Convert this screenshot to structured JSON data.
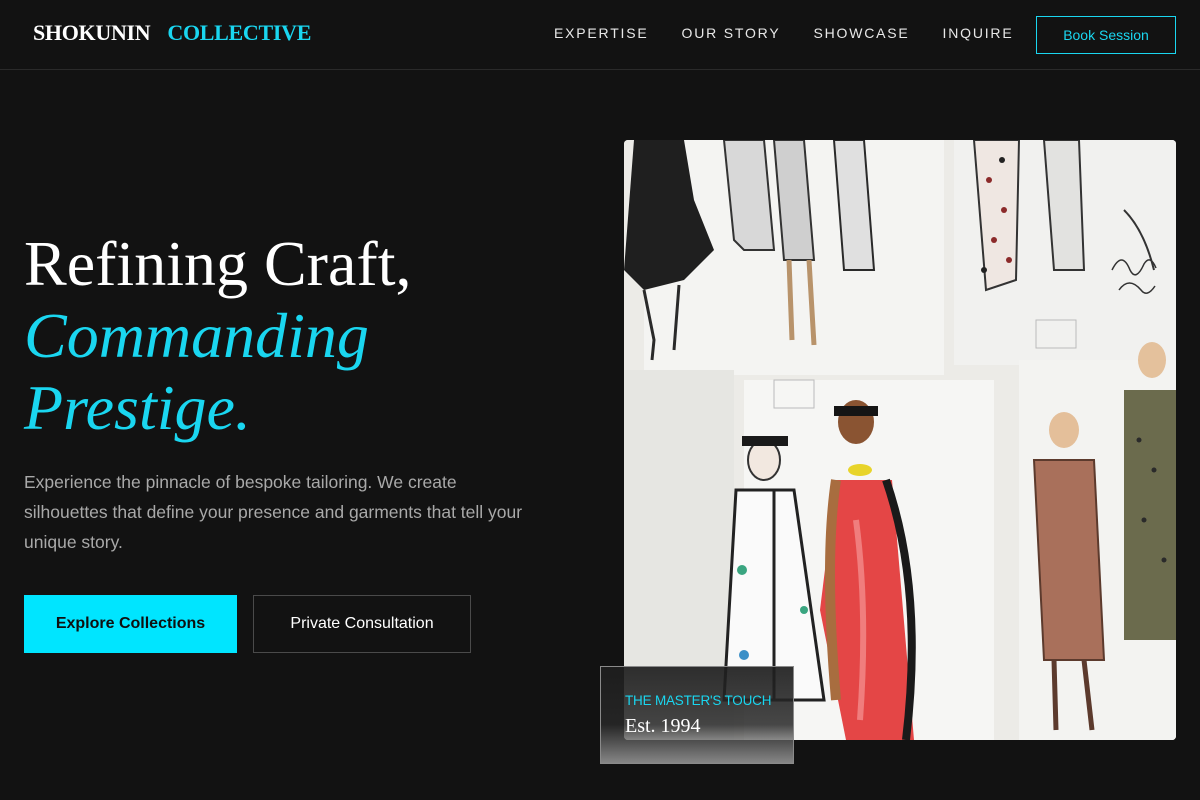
{
  "brand": {
    "name_part1": "SHOKUNIN",
    "name_part2": "COLLECTIVE"
  },
  "nav": {
    "items": [
      {
        "label": "EXPERTISE"
      },
      {
        "label": "OUR STORY"
      },
      {
        "label": "SHOWCASE"
      },
      {
        "label": "INQUIRE"
      }
    ],
    "cta_label": "Book Session"
  },
  "hero": {
    "title_line1": "Refining Craft,",
    "title_line2": "Commanding",
    "title_line3": "Prestige.",
    "description": "Experience the pinnacle of bespoke tailoring. We create silhouettes that define your presence and garments that tell your unique story.",
    "primary_button": "Explore Collections",
    "secondary_button": "Private Consultation"
  },
  "image": {
    "subject": "fashion illustration sketches pinned on a wall"
  },
  "badge": {
    "kicker": "THE MASTER'S TOUCH",
    "est": "Est. 1994"
  },
  "colors": {
    "accent": "#1ad6f0",
    "primary_button": "#00e5ff",
    "background": "#121212"
  }
}
